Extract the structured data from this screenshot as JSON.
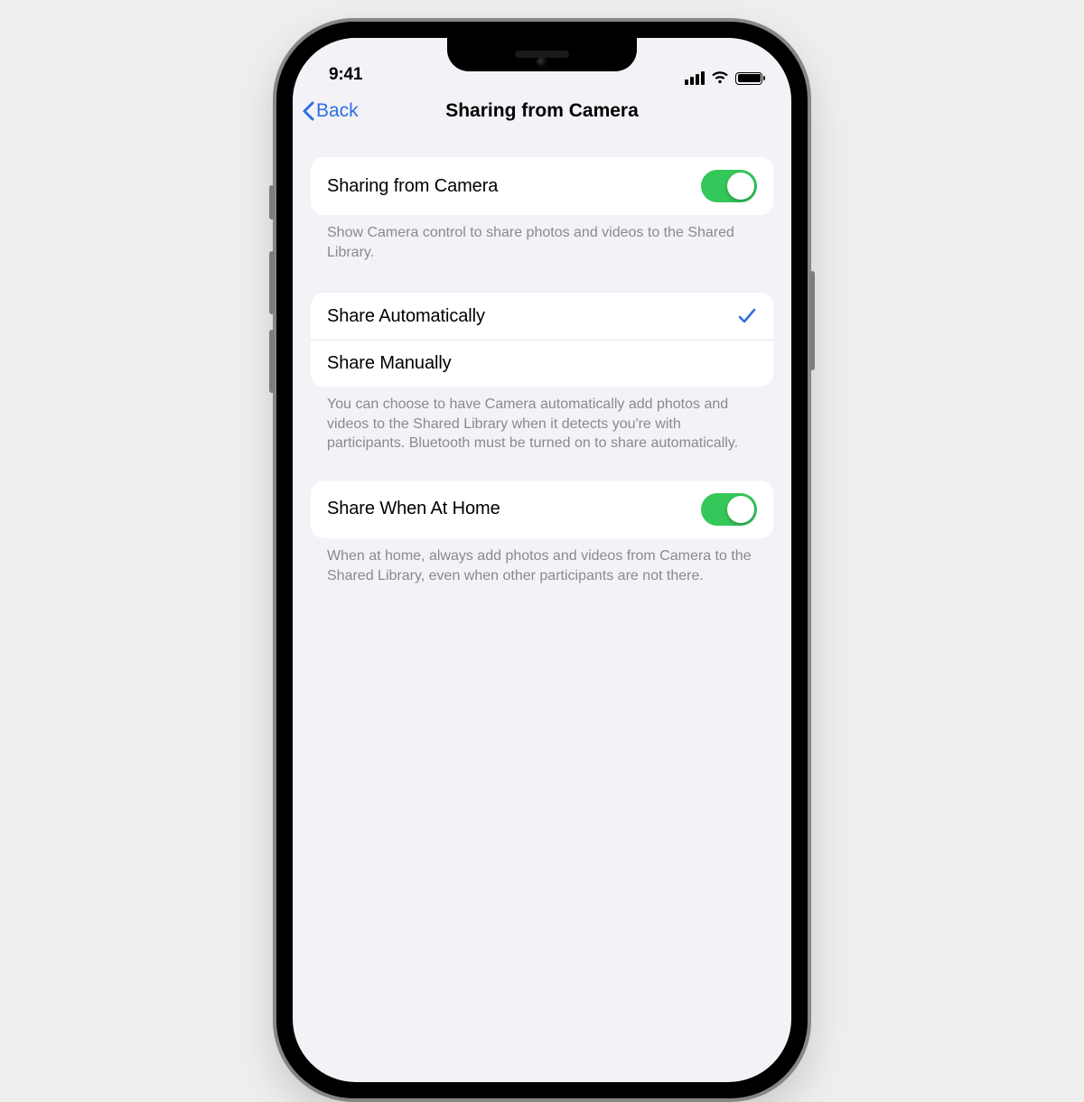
{
  "status": {
    "time": "9:41"
  },
  "nav": {
    "back_label": "Back",
    "title": "Sharing from Camera"
  },
  "sections": {
    "sharing_from_camera": {
      "label": "Sharing from Camera",
      "toggle_on": true,
      "footer": "Show Camera control to share photos and videos to the Shared Library."
    },
    "share_mode": {
      "options": [
        {
          "label": "Share Automatically",
          "selected": true
        },
        {
          "label": "Share Manually",
          "selected": false
        }
      ],
      "footer": "You can choose to have Camera automatically add photos and videos to the Shared Library when it detects you're with participants. Bluetooth must be turned on to share automatically."
    },
    "share_when_home": {
      "label": "Share When At Home",
      "toggle_on": true,
      "footer": "When at home, always add photos and videos from Camera to the Shared Library, even when other participants are not there."
    }
  },
  "colors": {
    "accent_blue": "#2f6fe0",
    "toggle_green": "#34c759",
    "page_bg": "#f2f2f7"
  }
}
